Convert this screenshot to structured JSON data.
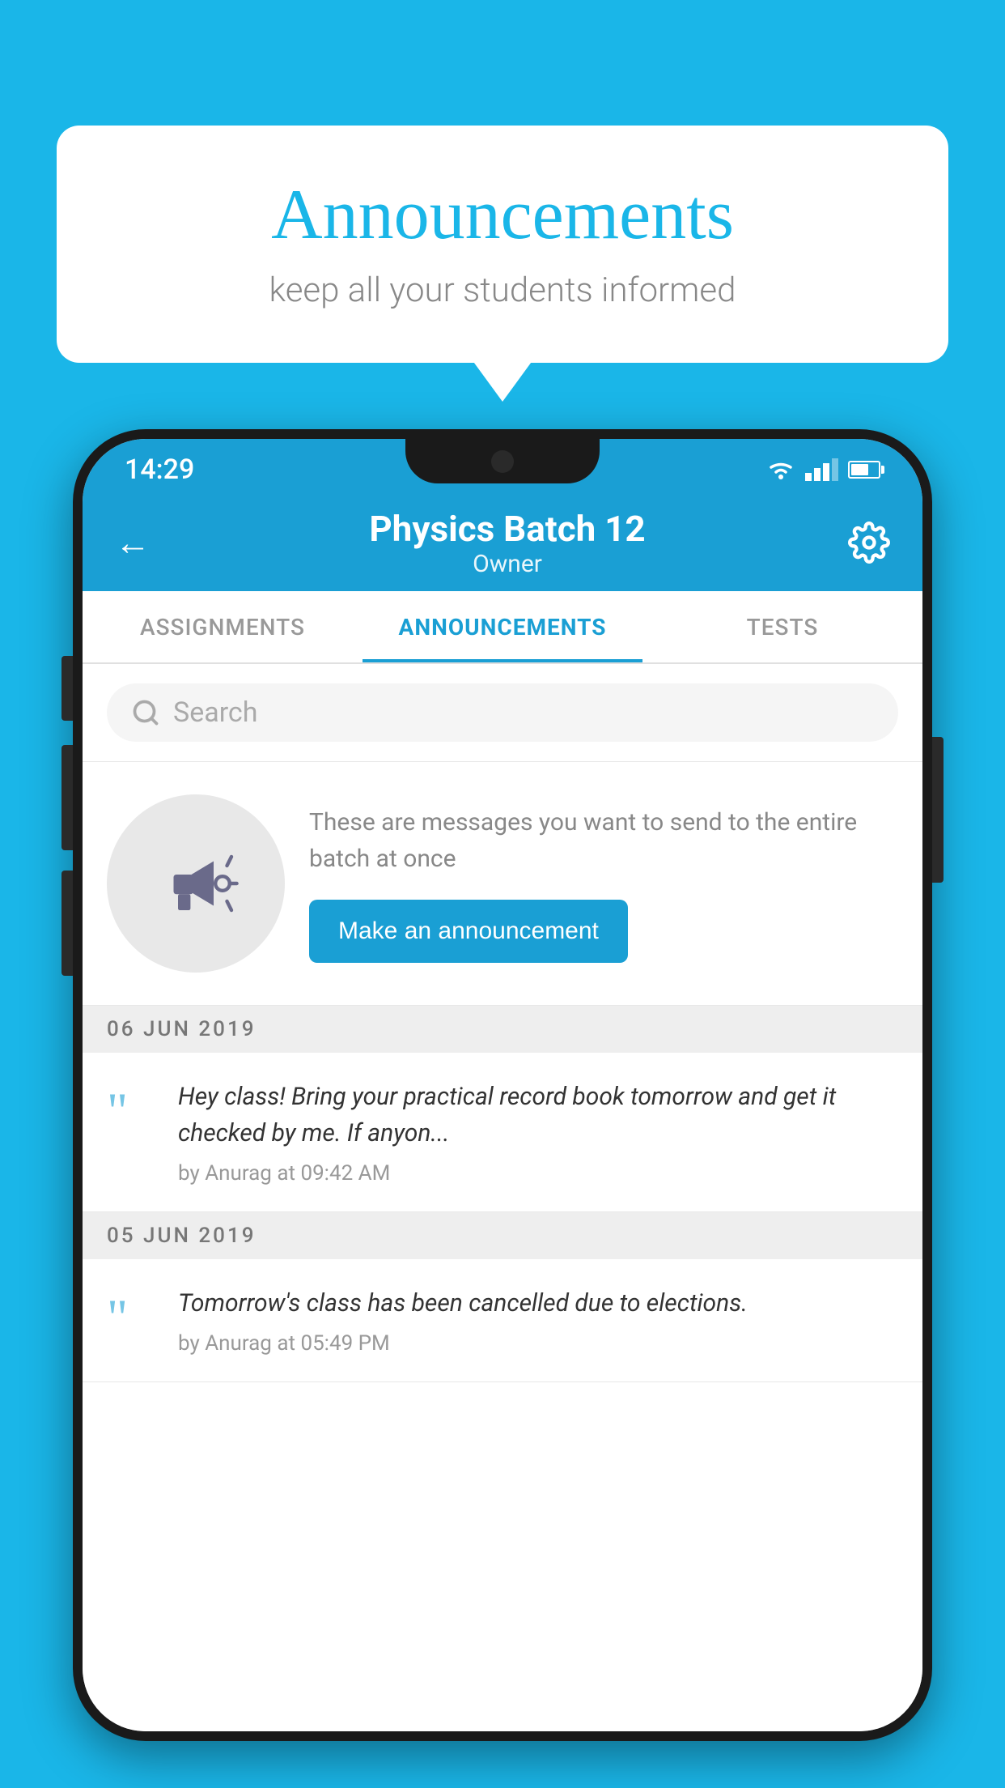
{
  "background": {
    "color": "#1ab6e8"
  },
  "speech_bubble": {
    "title": "Announcements",
    "subtitle": "keep all your students informed"
  },
  "phone": {
    "status_bar": {
      "time": "14:29"
    },
    "app_bar": {
      "title": "Physics Batch 12",
      "subtitle": "Owner",
      "back_label": "←"
    },
    "tabs": [
      {
        "label": "ASSIGNMENTS",
        "active": false
      },
      {
        "label": "ANNOUNCEMENTS",
        "active": true
      },
      {
        "label": "TESTS",
        "active": false
      }
    ],
    "search": {
      "placeholder": "Search"
    },
    "promo": {
      "description": "These are messages you want to send to the entire batch at once",
      "button_label": "Make an announcement"
    },
    "announcements": [
      {
        "date": "06  JUN  2019",
        "text": "Hey class! Bring your practical record book tomorrow and get it checked by me. If anyon...",
        "meta": "by Anurag at 09:42 AM"
      },
      {
        "date": "05  JUN  2019",
        "text": "Tomorrow's class has been cancelled due to elections.",
        "meta": "by Anurag at 05:49 PM"
      }
    ]
  }
}
